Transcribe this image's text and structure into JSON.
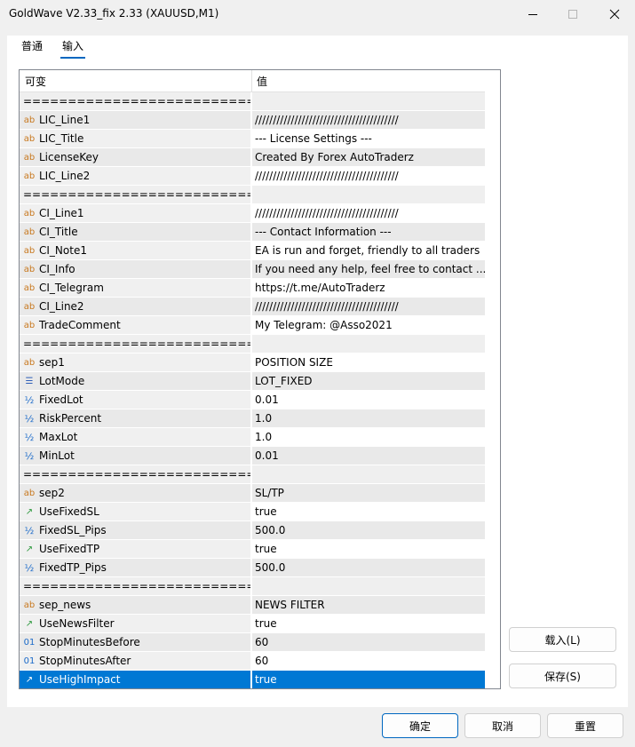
{
  "window": {
    "title": "GoldWave V2.33_fix 2.33 (XAUUSD,M1)"
  },
  "tabs": [
    {
      "label": "普通"
    },
    {
      "label": "输入"
    }
  ],
  "grid": {
    "col_variable": "可变",
    "col_value": "值",
    "rows": [
      {
        "type": "sep",
        "name": "============================",
        "value": ""
      },
      {
        "type": "string",
        "name": "LIC_Line1",
        "value": "////////////////////////////////////////"
      },
      {
        "type": "string",
        "name": "LIC_Title",
        "value": "--- License Settings ---"
      },
      {
        "type": "string",
        "name": "LicenseKey",
        "value": "Created By Forex AutoTraderz"
      },
      {
        "type": "string",
        "name": "LIC_Line2",
        "value": "////////////////////////////////////////"
      },
      {
        "type": "sep",
        "name": "============================",
        "value": ""
      },
      {
        "type": "string",
        "name": "CI_Line1",
        "value": "////////////////////////////////////////"
      },
      {
        "type": "string",
        "name": "CI_Title",
        "value": "--- Contact Information ---"
      },
      {
        "type": "string",
        "name": "CI_Note1",
        "value": "EA is run and forget, friendly to all traders"
      },
      {
        "type": "string",
        "name": "CI_Info",
        "value": "If you need any help, feel free to contact ..."
      },
      {
        "type": "string",
        "name": "CI_Telegram",
        "value": "https://t.me/AutoTraderz"
      },
      {
        "type": "string",
        "name": "CI_Line2",
        "value": "////////////////////////////////////////"
      },
      {
        "type": "string",
        "name": "TradeComment",
        "value": "My Telegram: @Asso2021"
      },
      {
        "type": "sep",
        "name": "============================",
        "value": ""
      },
      {
        "type": "string",
        "name": "sep1",
        "value": "POSITION SIZE"
      },
      {
        "type": "enum",
        "name": "LotMode",
        "value": "LOT_FIXED"
      },
      {
        "type": "double",
        "name": "FixedLot",
        "value": "0.01"
      },
      {
        "type": "double",
        "name": "RiskPercent",
        "value": "1.0"
      },
      {
        "type": "double",
        "name": "MaxLot",
        "value": "1.0"
      },
      {
        "type": "double",
        "name": "MinLot",
        "value": "0.01"
      },
      {
        "type": "sep",
        "name": "============================",
        "value": ""
      },
      {
        "type": "string",
        "name": "sep2",
        "value": "SL/TP"
      },
      {
        "type": "bool",
        "name": "UseFixedSL",
        "value": "true"
      },
      {
        "type": "double",
        "name": "FixedSL_Pips",
        "value": "500.0"
      },
      {
        "type": "bool",
        "name": "UseFixedTP",
        "value": "true"
      },
      {
        "type": "double",
        "name": "FixedTP_Pips",
        "value": "500.0"
      },
      {
        "type": "sep",
        "name": "============================",
        "value": ""
      },
      {
        "type": "string",
        "name": "sep_news",
        "value": "NEWS FILTER"
      },
      {
        "type": "bool",
        "name": "UseNewsFilter",
        "value": "true"
      },
      {
        "type": "int",
        "name": "StopMinutesBefore",
        "value": "60"
      },
      {
        "type": "int",
        "name": "StopMinutesAfter",
        "value": "60"
      },
      {
        "type": "bool",
        "name": "UseHighImpact",
        "value": "true",
        "selected": true
      }
    ]
  },
  "icons": {
    "string": "ab",
    "double": "½",
    "bool": "↗",
    "int": "01",
    "enum": "☰"
  },
  "buttons": {
    "load": "载入(L)",
    "save": "保存(S)",
    "ok": "确定",
    "cancel": "取消",
    "reset": "重置"
  },
  "colors": {
    "selection": "#0078d4",
    "accent": "#0067c0"
  }
}
